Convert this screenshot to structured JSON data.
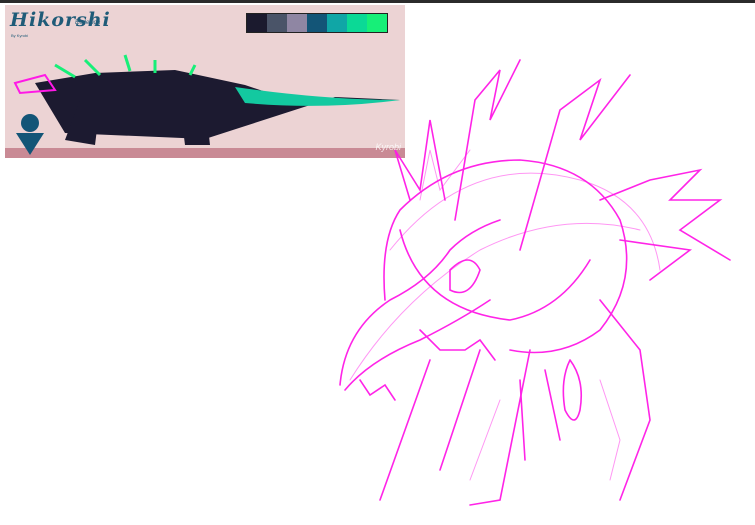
{
  "reference": {
    "title": "Hikorshi",
    "subtitle": "Redesign",
    "byline": "By Kyrobi",
    "watermark": "Kyrobi",
    "palette": [
      "#1b1a2e",
      "#4a5468",
      "#8f86a3",
      "#135577",
      "#10a6a6",
      "#0bd996",
      "#17ef78"
    ]
  },
  "canvas": {
    "stroke_color": "#ff19e6"
  }
}
